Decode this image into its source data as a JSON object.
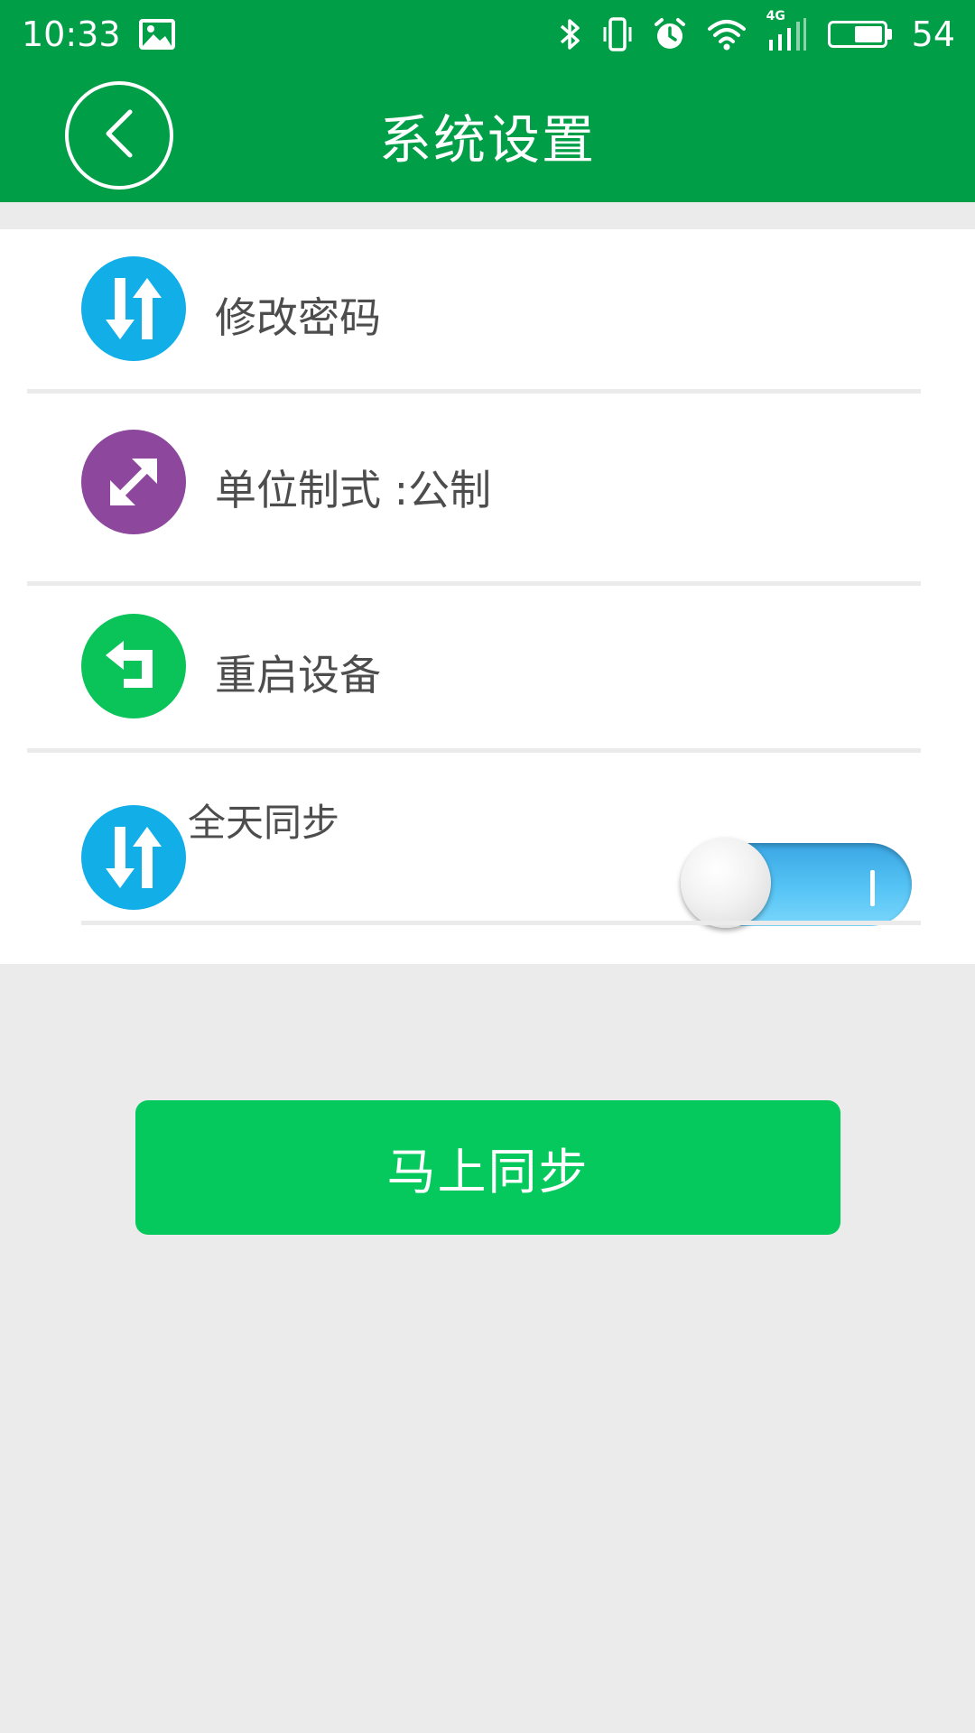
{
  "status_bar": {
    "time": "10:33",
    "battery_level": "54",
    "network_label": "4G",
    "icons": [
      "image-icon",
      "bluetooth-icon",
      "vibrate-icon",
      "alarm-icon",
      "wifi-icon",
      "signal-icon",
      "battery-icon"
    ]
  },
  "header": {
    "title": "系统设置",
    "back_icon": "chevron-left-icon"
  },
  "settings": {
    "items": [
      {
        "label": "修改密码",
        "icon": "swap-vertical-icon",
        "icon_color": "#12aee8"
      },
      {
        "label": "单位制式 :公制",
        "icon": "expand-diagonal-icon",
        "icon_color": "#8d479d"
      },
      {
        "label": "重启设备",
        "icon": "return-arrow-icon",
        "icon_color": "#0ac45a"
      },
      {
        "label": "全天同步",
        "icon": "swap-vertical-icon",
        "icon_color": "#12aee8",
        "toggle_on": true
      }
    ]
  },
  "actions": {
    "sync_now_label": "马上同步"
  },
  "colors": {
    "brand_green": "#009e47",
    "button_green": "#06c95e",
    "toggle_blue": "#56c4f5",
    "background": "#ebebeb"
  }
}
